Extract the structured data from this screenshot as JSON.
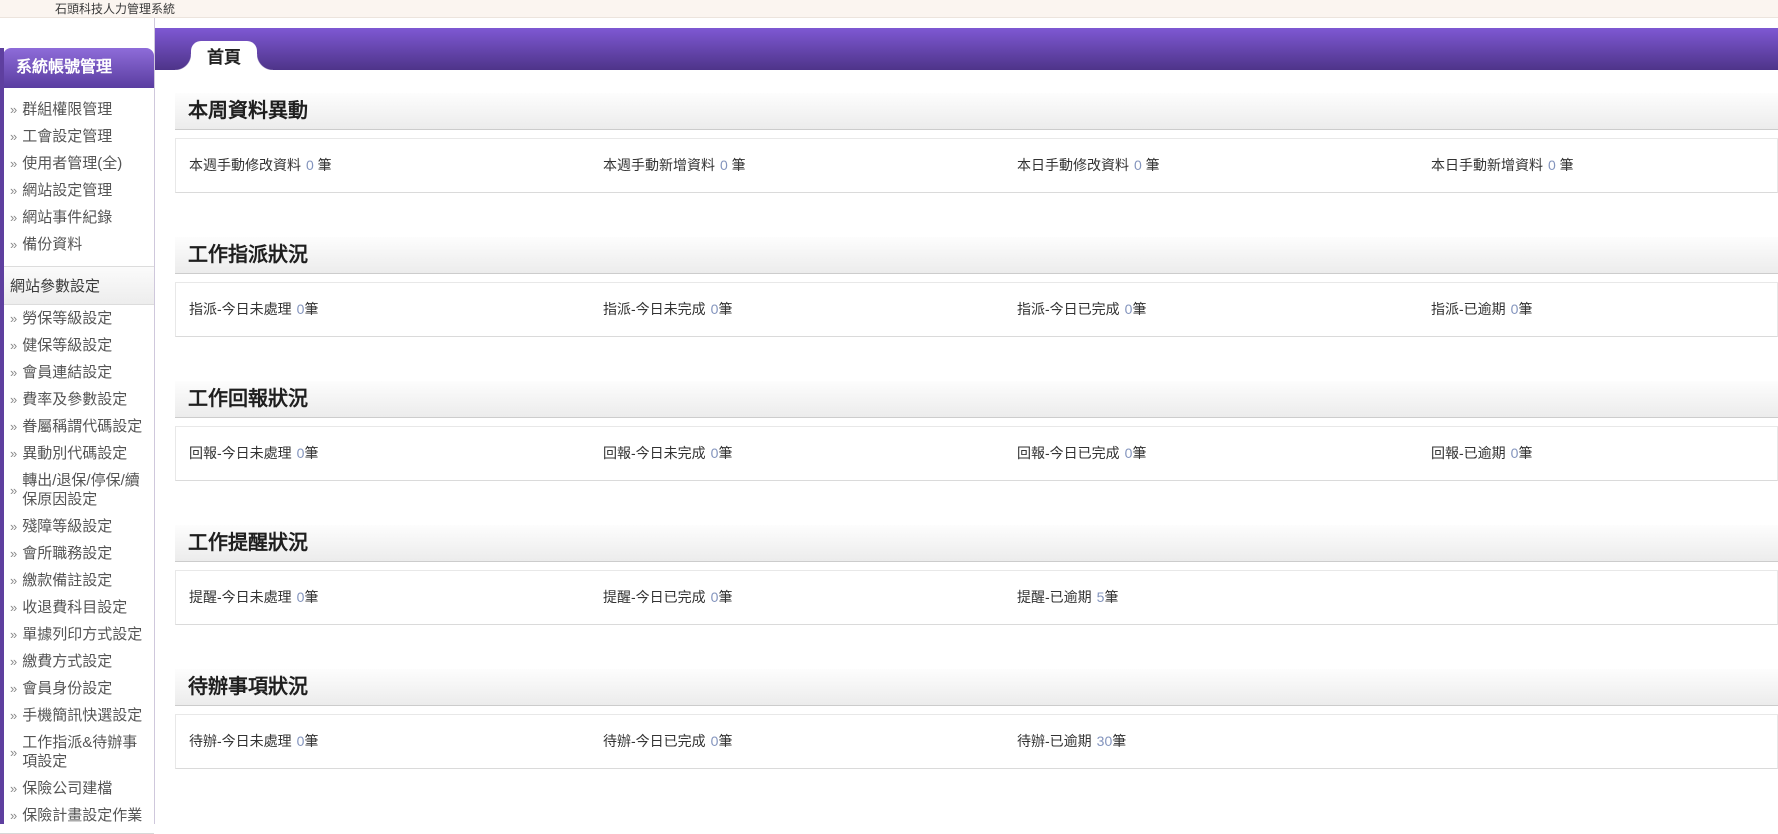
{
  "app": {
    "title": "石頭科技人力管理系統"
  },
  "tab": {
    "label": "首頁"
  },
  "sidebar": {
    "primary_header": "系統帳號管理",
    "groups": [
      {
        "items": [
          "群組權限管理",
          "工會設定管理",
          "使用者管理(全)",
          "網站設定管理",
          "網站事件紀錄",
          "備份資料"
        ]
      },
      {
        "header": "網站參數設定",
        "items": [
          "勞保等級設定",
          "健保等級設定",
          "會員連結設定",
          "費率及參數設定",
          "眷屬稱謂代碼設定",
          "異動別代碼設定",
          "轉出/退保/停保/續保原因設定",
          "殘障等級設定",
          "會所職務設定",
          "繳款備註設定",
          "收退費科目設定",
          "單據列印方式設定",
          "繳費方式設定",
          "會員身份設定",
          "手機簡訊快選設定",
          "工作指派&待辦事項設定",
          "保險公司建檔",
          "保險計畫設定作業"
        ]
      }
    ]
  },
  "main": {
    "sections": [
      {
        "title": "本周資料異動",
        "stats": [
          {
            "label": "本週手動修改資料",
            "value": "0",
            "unit": " 筆"
          },
          {
            "label": "本週手動新增資料",
            "value": "0",
            "unit": " 筆"
          },
          {
            "label": "本日手動修改資料",
            "value": "0",
            "unit": " 筆"
          },
          {
            "label": "本日手動新增資料",
            "value": "0",
            "unit": " 筆"
          }
        ]
      },
      {
        "title": "工作指派狀況",
        "stats": [
          {
            "label": "指派-今日未處理",
            "value": "0",
            "unit": "筆"
          },
          {
            "label": "指派-今日未完成",
            "value": "0",
            "unit": "筆"
          },
          {
            "label": "指派-今日已完成",
            "value": "0",
            "unit": "筆"
          },
          {
            "label": "指派-已逾期",
            "value": "0",
            "unit": "筆"
          }
        ]
      },
      {
        "title": "工作回報狀況",
        "stats": [
          {
            "label": "回報-今日未處理",
            "value": "0",
            "unit": "筆"
          },
          {
            "label": "回報-今日未完成",
            "value": "0",
            "unit": "筆"
          },
          {
            "label": "回報-今日已完成",
            "value": "0",
            "unit": "筆"
          },
          {
            "label": "回報-已逾期",
            "value": "0",
            "unit": "筆"
          }
        ]
      },
      {
        "title": "工作提醒狀況",
        "stats": [
          {
            "label": "提醒-今日未處理",
            "value": "0",
            "unit": "筆"
          },
          {
            "label": "提醒-今日已完成",
            "value": "0",
            "unit": "筆"
          },
          {
            "label": "提醒-已逾期",
            "value": "5",
            "unit": "筆"
          }
        ]
      },
      {
        "title": "待辦事項狀況",
        "stats": [
          {
            "label": "待辦-今日未處理",
            "value": "0",
            "unit": "筆"
          },
          {
            "label": "待辦-今日已完成",
            "value": "0",
            "unit": "筆"
          },
          {
            "label": "待辦-已逾期",
            "value": "30",
            "unit": "筆"
          }
        ]
      }
    ]
  },
  "colors": {
    "purple_bar_top": "#7e58d3",
    "purple_bar_bottom": "#4e3489",
    "sidebar_header_top": "#8e6cd9",
    "sidebar_header_bottom": "#5a3da0",
    "left_stripe": "#5e3f9f",
    "stat_value": "#8394bd",
    "topbar_bg": "#fbf5f0"
  }
}
